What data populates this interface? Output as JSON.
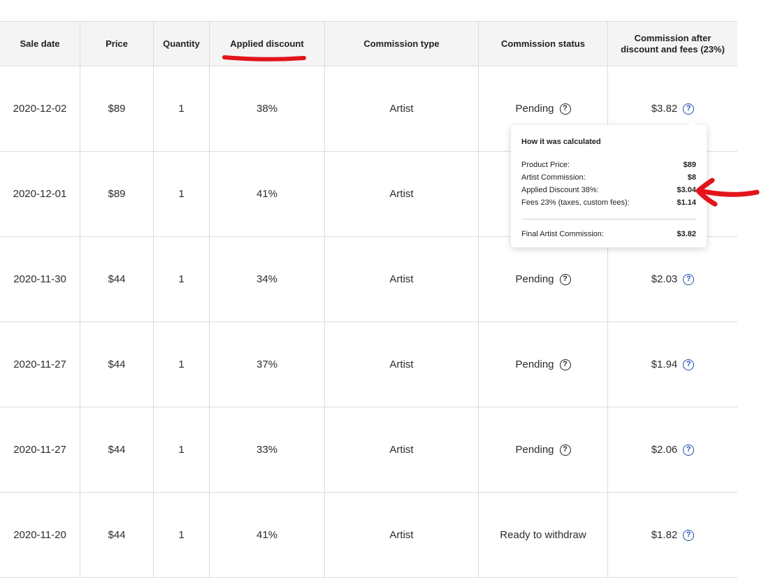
{
  "headers": [
    "Sale date",
    "Price",
    "Quantity",
    "Applied discount",
    "Commission type",
    "Commission status",
    "Commission after discount and fees (23%)"
  ],
  "rows": [
    {
      "date": "2020-12-02",
      "price": "$89",
      "qty": "1",
      "discount": "38%",
      "type": "Artist",
      "status": "Pending",
      "commission": "$3.82"
    },
    {
      "date": "2020-12-01",
      "price": "$89",
      "qty": "1",
      "discount": "41%",
      "type": "Artist",
      "status": "",
      "commission": ""
    },
    {
      "date": "2020-11-30",
      "price": "$44",
      "qty": "1",
      "discount": "34%",
      "type": "Artist",
      "status": "Pending",
      "commission": "$2.03"
    },
    {
      "date": "2020-11-27",
      "price": "$44",
      "qty": "1",
      "discount": "37%",
      "type": "Artist",
      "status": "Pending",
      "commission": "$1.94"
    },
    {
      "date": "2020-11-27",
      "price": "$44",
      "qty": "1",
      "discount": "33%",
      "type": "Artist",
      "status": "Pending",
      "commission": "$2.06"
    },
    {
      "date": "2020-11-20",
      "price": "$44",
      "qty": "1",
      "discount": "41%",
      "type": "Artist",
      "status": "Ready to withdraw",
      "commission": "$1.82"
    }
  ],
  "help_glyph": "?",
  "tooltip": {
    "title": "How it was calculated",
    "lines": [
      {
        "label": "Product Price:",
        "value": "$89"
      },
      {
        "label": "Artist Commission:",
        "value": "$8"
      },
      {
        "label": "Applied Discount 38%:",
        "value": "$3.04"
      },
      {
        "label": "Fees 23% (taxes, custom fees):",
        "value": "$1.14"
      }
    ],
    "final_label": "Final Artist Commission:",
    "final_value": "$3.82"
  },
  "colors": {
    "annotation": "#e3141b",
    "help_icon": "#1d4ea8",
    "header_bg": "#f4f4f4"
  }
}
